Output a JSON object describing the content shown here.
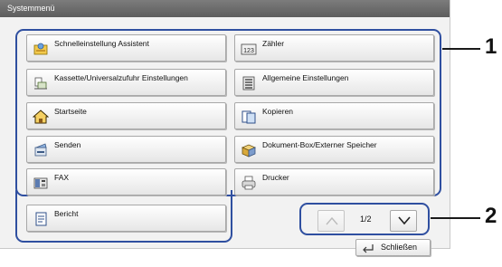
{
  "window": {
    "title": "Systemmenü"
  },
  "menu": {
    "left": [
      {
        "label": "Schnelleinstellung Assistent",
        "icon": "wizard-icon"
      },
      {
        "label": "Kassette/Universalzufuhr Einstellungen",
        "icon": "cassette-icon"
      },
      {
        "label": "Startseite",
        "icon": "home-icon"
      },
      {
        "label": "Senden",
        "icon": "send-icon"
      },
      {
        "label": "FAX",
        "icon": "fax-icon"
      },
      {
        "label": "Bericht",
        "icon": "report-icon"
      }
    ],
    "right": [
      {
        "label": "Zähler",
        "icon": "counter-icon",
        "icon_text": "123"
      },
      {
        "label": "Allgemeine Einstellungen",
        "icon": "settings-icon"
      },
      {
        "label": "Kopieren",
        "icon": "copy-icon"
      },
      {
        "label": "Dokument-Box/Externer Speicher",
        "icon": "document-box-icon"
      },
      {
        "label": "Drucker",
        "icon": "printer-icon"
      }
    ]
  },
  "pager": {
    "indicator": "1/2",
    "up_icon": "chevron-up-icon",
    "down_icon": "chevron-down-icon"
  },
  "close": {
    "label": "Schließen",
    "icon": "return-arrow-icon"
  },
  "callouts": [
    "1",
    "2"
  ],
  "colors": {
    "outline": "#2f4fa0",
    "titlebar": "#6b6b6b"
  }
}
